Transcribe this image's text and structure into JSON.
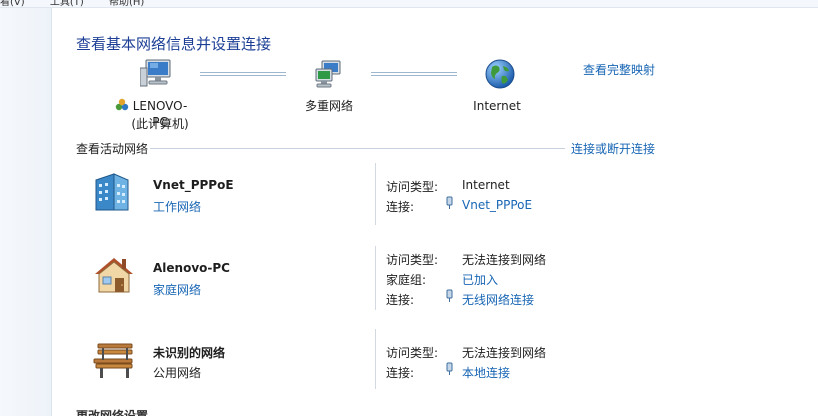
{
  "menu": [
    "看(V)",
    "工具(T)",
    "帮助(H)"
  ],
  "title": "查看基本网络信息并设置连接",
  "view_full_map": "查看完整映射",
  "map": {
    "computer": "LENOVO-PC",
    "computer_sub": "(此计算机)",
    "network": "多重网络",
    "internet": "Internet"
  },
  "active_networks": {
    "heading": "查看活动网络",
    "connect_link": "连接或断开连接"
  },
  "networks": [
    {
      "name": "Vnet_PPPoE",
      "type": "工作网络",
      "rows": [
        {
          "key": "访问类型:",
          "value": "Internet"
        },
        {
          "key": "连接:",
          "value": "Vnet_PPPoE"
        }
      ]
    },
    {
      "name": "Alenovo-PC",
      "type": "家庭网络",
      "rows": [
        {
          "key": "访问类型:",
          "value": "无法连接到网络"
        },
        {
          "key": "家庭组:",
          "value": "已加入"
        },
        {
          "key": "连接:",
          "value": "无线网络连接"
        }
      ]
    },
    {
      "name": "未识别的网络",
      "type": "公用网络",
      "rows": [
        {
          "key": "访问类型:",
          "value": "无法连接到网络"
        },
        {
          "key": "连接:",
          "value": "本地连接"
        }
      ]
    }
  ],
  "bottom_heading": "更改网络设置",
  "colors": {
    "title": "#1c3f95",
    "link": "#1866b4"
  }
}
